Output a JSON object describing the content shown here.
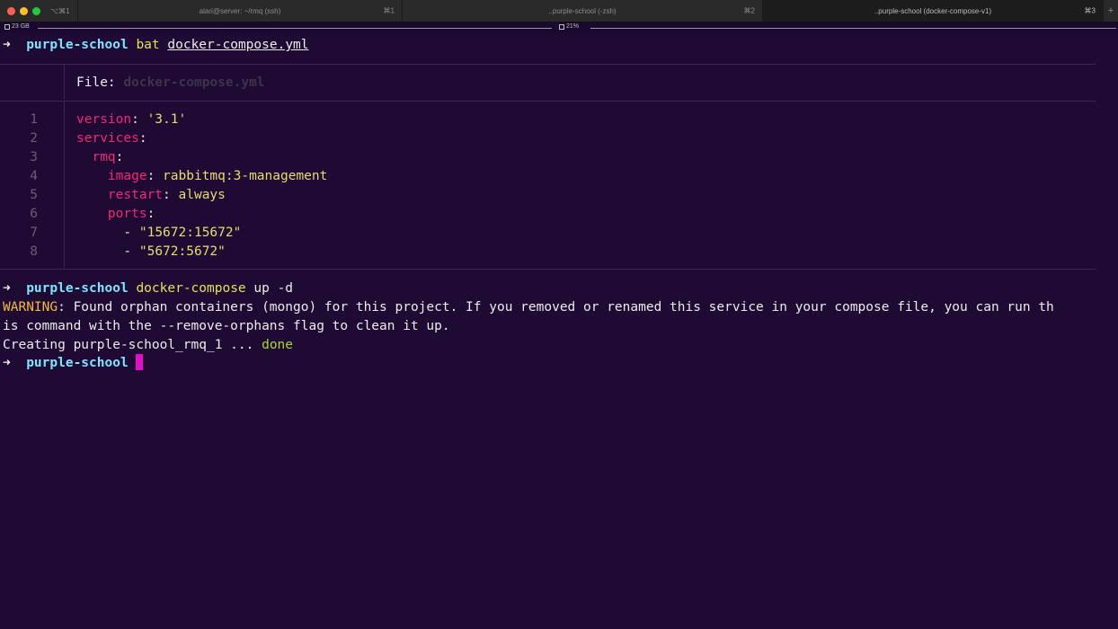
{
  "window": {
    "shortcut": "⌥⌘1",
    "tabs": [
      {
        "title": "alari@server: ~/rmq (ssh)",
        "shortcut": "⌘1"
      },
      {
        "title": "..purple-school (-zsh)",
        "shortcut": "⌘2"
      },
      {
        "title": "..purple-school (docker-compose-v1)",
        "shortcut": "⌘3"
      }
    ],
    "new_tab": "+"
  },
  "status": {
    "disk": "23 GB",
    "cpu": "21%"
  },
  "terminal": {
    "prompt_arrow": "➜",
    "prompt_dir": "purple-school",
    "cmd1": {
      "program": "bat",
      "arg": "docker-compose.yml"
    },
    "file_header": {
      "label": "File: ",
      "name": "docker-compose.yml"
    },
    "file_lines": [
      {
        "num": "1",
        "indent": "",
        "key": "version",
        "sep": ": ",
        "val": "'3.1'"
      },
      {
        "num": "2",
        "indent": "",
        "key": "services",
        "sep": ":",
        "val": ""
      },
      {
        "num": "3",
        "indent": "  ",
        "key": "rmq",
        "sep": ":",
        "val": ""
      },
      {
        "num": "4",
        "indent": "    ",
        "key": "image",
        "sep": ": ",
        "val": "rabbitmq:3-management"
      },
      {
        "num": "5",
        "indent": "    ",
        "key": "restart",
        "sep": ": ",
        "val": "always"
      },
      {
        "num": "6",
        "indent": "    ",
        "key": "ports",
        "sep": ":",
        "val": ""
      },
      {
        "num": "7",
        "indent": "      ",
        "key": "",
        "sep": "- ",
        "val": "\"15672:15672\""
      },
      {
        "num": "8",
        "indent": "      ",
        "key": "",
        "sep": "- ",
        "val": "\"5672:5672\""
      }
    ],
    "cmd2": {
      "program": "docker-compose",
      "args": " up -d"
    },
    "warning": {
      "label": "WARNING",
      "line1_rest": ": Found orphan containers (mongo) for this project. If you removed or renamed this service in your compose file, you can run th",
      "line2": "is command with the --remove-orphans flag to clean it up."
    },
    "creating": {
      "text": "Creating purple-school_rmq_1 ... ",
      "status": "done"
    }
  },
  "colors": {
    "background": "#1f0a33",
    "cursor": "#e20fc9",
    "key": "#f5267a",
    "string": "#e7db74",
    "prompt": "#7fe3ff"
  }
}
